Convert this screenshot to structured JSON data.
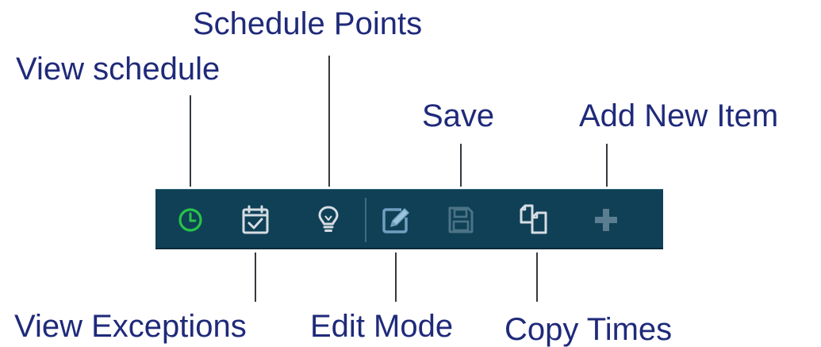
{
  "callouts": {
    "view_schedule": "View schedule",
    "schedule_points": "Schedule Points",
    "save": "Save",
    "add_new_item": "Add New Item",
    "view_exceptions": "View Exceptions",
    "edit_mode": "Edit Mode",
    "copy_times": "Copy Times"
  },
  "toolbar": {
    "buttons": [
      {
        "icon": "clock-icon",
        "state": "active",
        "color": "#28c24a"
      },
      {
        "icon": "calendar-check-icon",
        "state": "enabled",
        "color": "#d6dde3"
      },
      {
        "icon": "lightbulb-icon",
        "state": "enabled",
        "color": "#d6dde3"
      },
      {
        "icon": "edit-pencil-icon",
        "state": "selected",
        "color": "#6f9fc0"
      },
      {
        "icon": "floppy-disk-icon",
        "state": "disabled",
        "color": "#4c7386"
      },
      {
        "icon": "copy-pages-icon",
        "state": "enabled",
        "color": "#d6dde3"
      },
      {
        "icon": "plus-icon",
        "state": "disabled",
        "color": "#5a7e90"
      }
    ]
  },
  "colors": {
    "toolbar_background": "#0f4056",
    "label_text": "#1f2a7a",
    "leader_line": "#33393f"
  }
}
